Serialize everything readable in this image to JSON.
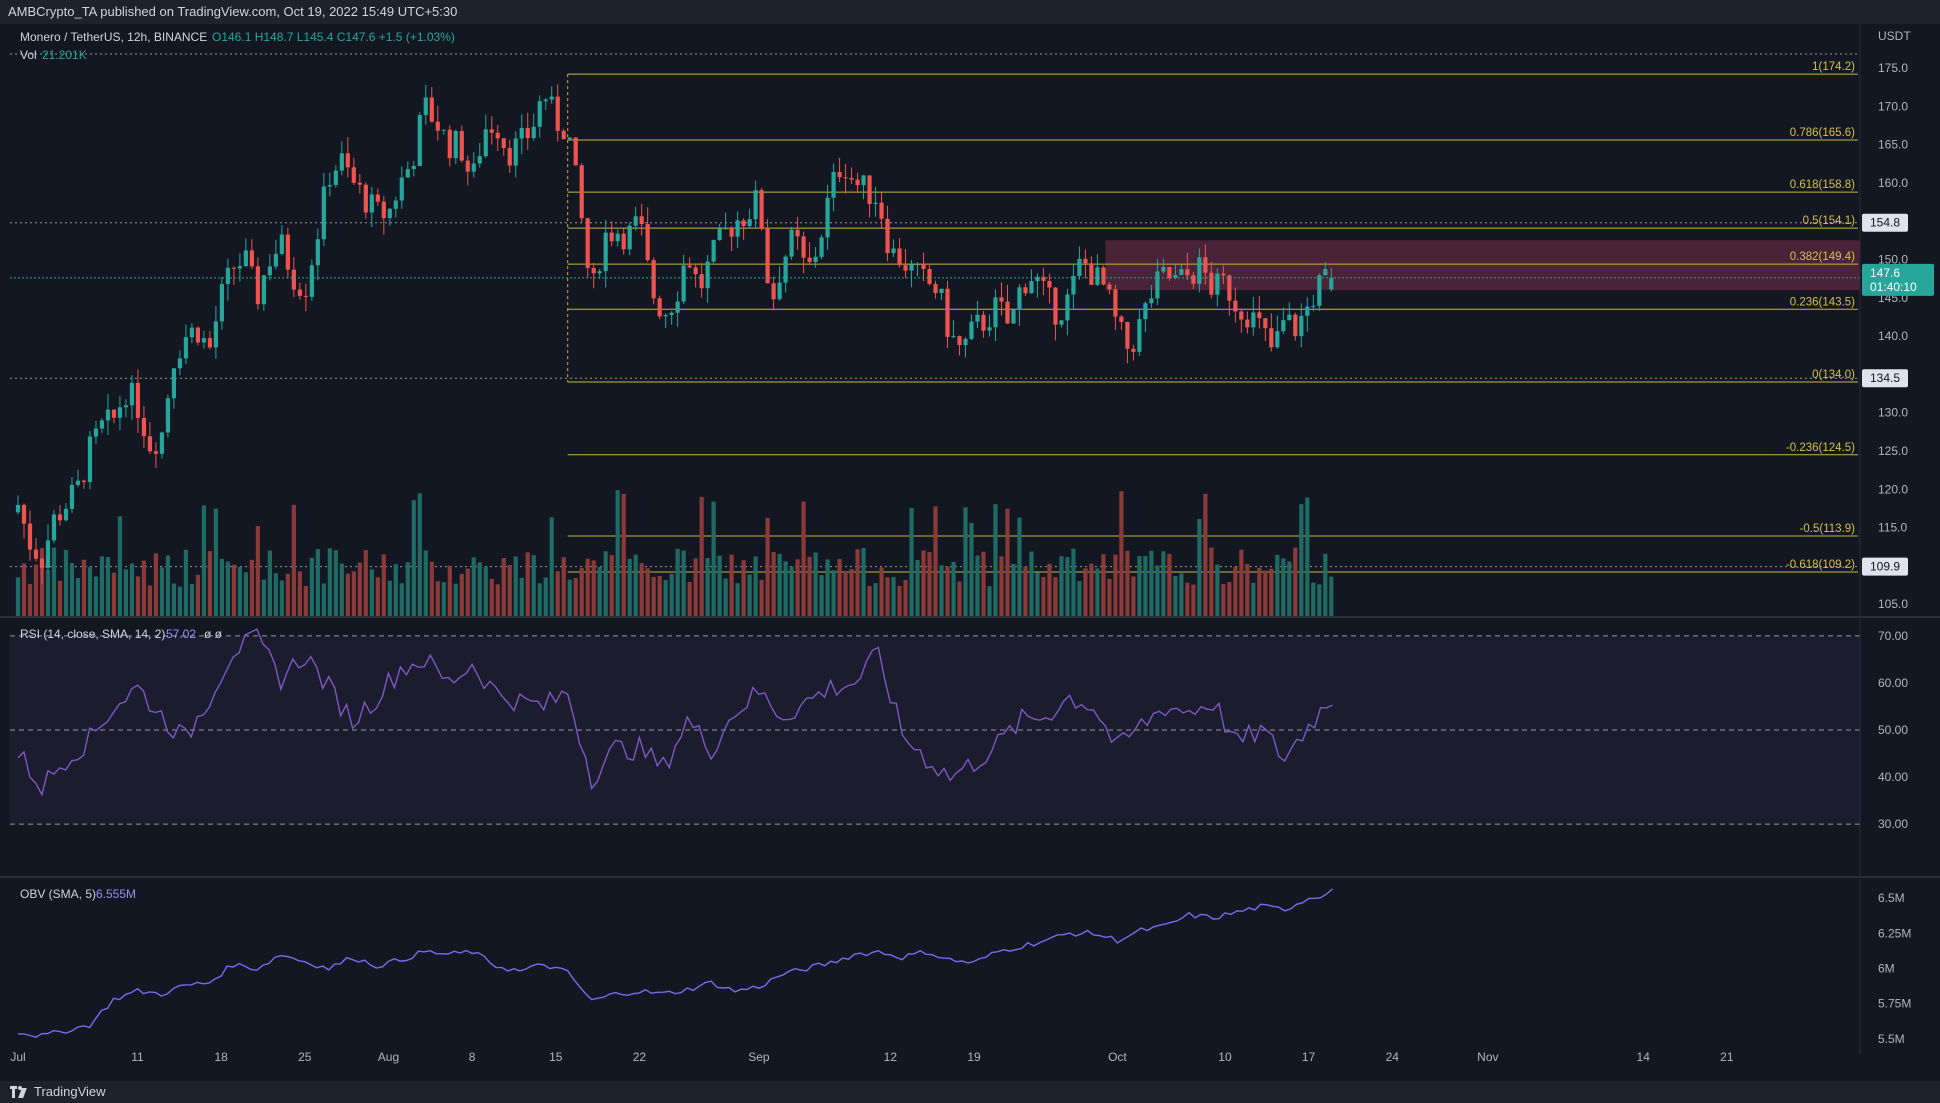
{
  "header": {
    "publisher": "AMBCrypto_TA published on TradingView.com, Oct 19, 2022 15:49 UTC+5:30"
  },
  "footer": {
    "brand": "TradingView"
  },
  "colors": {
    "background": "#131722",
    "up": "#26a69a",
    "down": "#ef5350",
    "up_vol": "#1f6b63",
    "down_vol": "#8b3a3a",
    "fib": "#c8b642",
    "rsi": "#7e57c2",
    "obv": "#7b68ee",
    "zone": "#7a2d4d"
  },
  "main_legend": {
    "pair": "Monero / TetherUS, 12h, BINANCE",
    "ohlc": "O146.1 H148.7 L145.4 C147.6 +1.5 (+1.03%)",
    "vol_label": "Vol",
    "vol_value": "21.201K"
  },
  "rsi_legend": {
    "label": "RSI (14, close, SMA, 14, 2)",
    "value": "57.02",
    "extra": "ø ø"
  },
  "obv_legend": {
    "label": "OBV (SMA, 5)",
    "value": "6.555M"
  },
  "price_axis": {
    "currency": "USDT",
    "ticks": [
      "175.0",
      "170.0",
      "165.0",
      "160.0",
      "155.0",
      "150.0",
      "145.0",
      "140.0",
      "135.0",
      "130.0",
      "125.0",
      "120.0",
      "115.0",
      "110.0",
      "105.0"
    ],
    "tick_values": [
      175,
      170,
      165,
      160,
      155,
      150,
      145,
      140,
      135,
      130,
      125,
      120,
      115,
      110,
      105
    ],
    "badges": [
      {
        "text": "154.8",
        "value": 154.8
      },
      {
        "text": "134.5",
        "value": 134.5
      },
      {
        "text": "109.9",
        "value": 109.9
      }
    ],
    "current_price": "147.6",
    "countdown": "01:40:10"
  },
  "rsi_axis": {
    "ticks": [
      "70.00",
      "60.00",
      "50.00",
      "40.00",
      "30.00"
    ],
    "values": [
      70,
      60,
      50,
      40,
      30
    ]
  },
  "obv_axis": {
    "ticks": [
      "6.5M",
      "6.25M",
      "6M",
      "5.75M",
      "5.5M"
    ],
    "values": [
      6.5,
      6.25,
      6.0,
      5.75,
      5.5
    ]
  },
  "time_axis": {
    "labels": [
      "Jul",
      "11",
      "18",
      "25",
      "Aug",
      "8",
      "15",
      "22",
      "Sep",
      "12",
      "19",
      "Oct",
      "10",
      "17",
      "24",
      "Nov",
      "14",
      "21"
    ],
    "day_index": [
      0,
      10,
      17,
      24,
      31,
      38,
      45,
      52,
      62,
      73,
      80,
      92,
      101,
      108,
      115,
      123,
      136,
      143
    ]
  },
  "chart_data": {
    "type": "candlestick",
    "symbol": "Monero / TetherUS",
    "interval": "12h",
    "exchange": "BINANCE",
    "ylim": [
      101,
      178
    ],
    "fib_levels": [
      {
        "label": "1(174.2)",
        "value": 174.2
      },
      {
        "label": "0.786(165.6)",
        "value": 165.6
      },
      {
        "label": "0.618(158.8)",
        "value": 158.8
      },
      {
        "label": "0.5(154.1)",
        "value": 154.1
      },
      {
        "label": "0.382(149.4)",
        "value": 149.4
      },
      {
        "label": "0.236(143.5)",
        "value": 143.5
      },
      {
        "label": "0(134.0)",
        "value": 134.0
      },
      {
        "label": "-0.236(124.5)",
        "value": 124.5
      },
      {
        "label": "-0.5(113.9)",
        "value": 113.9
      },
      {
        "label": "-0.618(109.2)",
        "value": 109.2
      }
    ],
    "zone": {
      "from": 146,
      "to": 152.5
    },
    "close_path": [
      [
        0,
        118
      ],
      [
        1,
        113
      ],
      [
        2,
        111
      ],
      [
        3,
        116
      ],
      [
        4,
        118
      ],
      [
        5,
        120
      ],
      [
        6,
        125
      ],
      [
        7,
        128
      ],
      [
        8,
        129
      ],
      [
        9,
        133
      ],
      [
        10,
        131
      ],
      [
        11,
        126
      ],
      [
        12,
        127
      ],
      [
        13,
        137
      ],
      [
        14,
        140
      ],
      [
        15,
        141
      ],
      [
        16,
        138
      ],
      [
        17,
        145
      ],
      [
        18,
        149
      ],
      [
        19,
        150
      ],
      [
        20,
        145
      ],
      [
        21,
        150
      ],
      [
        22,
        152
      ],
      [
        23,
        148
      ],
      [
        24,
        146
      ],
      [
        25,
        153
      ],
      [
        26,
        161
      ],
      [
        27,
        163
      ],
      [
        28,
        160
      ],
      [
        29,
        158
      ],
      [
        30,
        156
      ],
      [
        31,
        156
      ],
      [
        32,
        160
      ],
      [
        33,
        163
      ],
      [
        34,
        170
      ],
      [
        35,
        168
      ],
      [
        36,
        165
      ],
      [
        37,
        165
      ],
      [
        38,
        160
      ],
      [
        39,
        167
      ],
      [
        40,
        168
      ],
      [
        41,
        164
      ],
      [
        42,
        165
      ],
      [
        43,
        167
      ],
      [
        44,
        172
      ],
      [
        45,
        168
      ],
      [
        46,
        167
      ],
      [
        47,
        157
      ],
      [
        48,
        145
      ],
      [
        49,
        153
      ],
      [
        50,
        154
      ],
      [
        51,
        153
      ],
      [
        52,
        155
      ],
      [
        53,
        146
      ],
      [
        54,
        143
      ],
      [
        55,
        145
      ],
      [
        56,
        151
      ],
      [
        57,
        146
      ],
      [
        58,
        150
      ],
      [
        59,
        153
      ],
      [
        60,
        155
      ],
      [
        61,
        156
      ],
      [
        62,
        158
      ],
      [
        63,
        144
      ],
      [
        64,
        150
      ],
      [
        65,
        153
      ],
      [
        66,
        148
      ],
      [
        67,
        152
      ],
      [
        68,
        159
      ],
      [
        69,
        163
      ],
      [
        70,
        160
      ],
      [
        71,
        159
      ],
      [
        72,
        158
      ],
      [
        73,
        151
      ],
      [
        74,
        150
      ],
      [
        75,
        148
      ],
      [
        76,
        147
      ],
      [
        77,
        146
      ],
      [
        78,
        140
      ],
      [
        79,
        138
      ],
      [
        80,
        141
      ],
      [
        81,
        142
      ],
      [
        82,
        144
      ],
      [
        83,
        141
      ],
      [
        84,
        147
      ],
      [
        85,
        148
      ],
      [
        86,
        145
      ],
      [
        87,
        143
      ],
      [
        88,
        145
      ],
      [
        89,
        150
      ],
      [
        90,
        148
      ],
      [
        91,
        146
      ],
      [
        92,
        141
      ],
      [
        93,
        138
      ],
      [
        94,
        142
      ],
      [
        95,
        146
      ],
      [
        96,
        148
      ],
      [
        97,
        147
      ],
      [
        98,
        148
      ],
      [
        99,
        149
      ],
      [
        100,
        146
      ],
      [
        101,
        147
      ],
      [
        102,
        144
      ],
      [
        103,
        143
      ],
      [
        104,
        141
      ],
      [
        105,
        138
      ],
      [
        106,
        142
      ],
      [
        107,
        141
      ],
      [
        108,
        144
      ],
      [
        109,
        147
      ],
      [
        109.9,
        147.6
      ]
    ],
    "candle_count": 220,
    "last_candle": {
      "open": 146.1,
      "high": 148.7,
      "low": 145.4,
      "close": 147.6
    },
    "volume_last": "21.201K",
    "rsi": {
      "ylim": [
        26,
        74
      ],
      "last": 57.02,
      "bands": [
        70,
        50,
        30
      ],
      "path": [
        [
          0,
          45
        ],
        [
          2,
          38
        ],
        [
          4,
          44
        ],
        [
          6,
          48
        ],
        [
          8,
          55
        ],
        [
          10,
          59
        ],
        [
          12,
          53
        ],
        [
          14,
          48
        ],
        [
          16,
          57
        ],
        [
          18,
          67
        ],
        [
          20,
          69
        ],
        [
          22,
          61
        ],
        [
          24,
          66
        ],
        [
          26,
          59
        ],
        [
          28,
          52
        ],
        [
          30,
          57
        ],
        [
          32,
          63
        ],
        [
          34,
          65
        ],
        [
          36,
          60
        ],
        [
          38,
          64
        ],
        [
          40,
          58
        ],
        [
          42,
          56
        ],
        [
          44,
          55
        ],
        [
          46,
          58
        ],
        [
          48,
          40
        ],
        [
          50,
          46
        ],
        [
          52,
          46
        ],
        [
          54,
          42
        ],
        [
          56,
          52
        ],
        [
          58,
          46
        ],
        [
          60,
          54
        ],
        [
          62,
          58
        ],
        [
          64,
          53
        ],
        [
          66,
          56
        ],
        [
          68,
          59
        ],
        [
          70,
          60
        ],
        [
          72,
          66
        ],
        [
          74,
          49
        ],
        [
          76,
          44
        ],
        [
          78,
          40
        ],
        [
          80,
          43
        ],
        [
          82,
          47
        ],
        [
          84,
          52
        ],
        [
          86,
          53
        ],
        [
          88,
          57
        ],
        [
          90,
          55
        ],
        [
          92,
          46
        ],
        [
          94,
          51
        ],
        [
          96,
          55
        ],
        [
          98,
          54
        ],
        [
          100,
          56
        ],
        [
          102,
          47
        ],
        [
          104,
          50
        ],
        [
          106,
          44
        ],
        [
          108,
          51
        ],
        [
          109,
          54
        ],
        [
          110,
          57
        ]
      ]
    },
    "obv": {
      "ylim": [
        5.4,
        6.7
      ],
      "last": 6.555,
      "path": [
        [
          0,
          5.55
        ],
        [
          2,
          5.52
        ],
        [
          4,
          5.56
        ],
        [
          6,
          5.6
        ],
        [
          8,
          5.78
        ],
        [
          10,
          5.84
        ],
        [
          12,
          5.82
        ],
        [
          14,
          5.88
        ],
        [
          16,
          5.9
        ],
        [
          18,
          6.03
        ],
        [
          20,
          6.0
        ],
        [
          22,
          6.1
        ],
        [
          24,
          6.05
        ],
        [
          26,
          6.0
        ],
        [
          28,
          6.08
        ],
        [
          30,
          6.02
        ],
        [
          32,
          6.06
        ],
        [
          34,
          6.12
        ],
        [
          36,
          6.1
        ],
        [
          38,
          6.12
        ],
        [
          40,
          6.02
        ],
        [
          42,
          5.98
        ],
        [
          44,
          6.03
        ],
        [
          46,
          5.97
        ],
        [
          48,
          5.77
        ],
        [
          50,
          5.82
        ],
        [
          52,
          5.84
        ],
        [
          54,
          5.82
        ],
        [
          56,
          5.85
        ],
        [
          58,
          5.9
        ],
        [
          60,
          5.84
        ],
        [
          62,
          5.87
        ],
        [
          64,
          5.96
        ],
        [
          66,
          6.0
        ],
        [
          68,
          6.04
        ],
        [
          70,
          6.1
        ],
        [
          72,
          6.12
        ],
        [
          74,
          6.08
        ],
        [
          76,
          6.12
        ],
        [
          78,
          6.06
        ],
        [
          80,
          6.04
        ],
        [
          82,
          6.12
        ],
        [
          84,
          6.16
        ],
        [
          86,
          6.2
        ],
        [
          88,
          6.25
        ],
        [
          90,
          6.25
        ],
        [
          92,
          6.2
        ],
        [
          94,
          6.27
        ],
        [
          96,
          6.3
        ],
        [
          98,
          6.38
        ],
        [
          100,
          6.36
        ],
        [
          102,
          6.4
        ],
        [
          104,
          6.44
        ],
        [
          106,
          6.42
        ],
        [
          108,
          6.5
        ],
        [
          109,
          6.52
        ],
        [
          110,
          6.56
        ]
      ]
    }
  }
}
